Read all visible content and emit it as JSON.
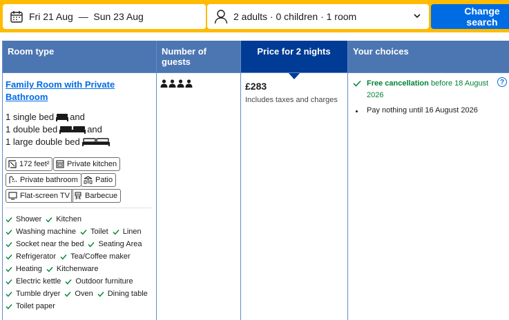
{
  "search": {
    "dates": "Fri 21 Aug  —  Sun 23 Aug",
    "guests": "2 adults · 0 children · 1 room",
    "change_label": "Change search"
  },
  "table": {
    "headers": [
      "Room type",
      "Number of guests",
      "Price for 2 nights",
      "Your choices"
    ]
  },
  "room": {
    "name": "Family Room with Private Bathroom",
    "beds": [
      {
        "text": "1 single bed",
        "suffix": "and"
      },
      {
        "text": "1 double bed",
        "suffix": "and"
      },
      {
        "text": "1 large double bed",
        "suffix": ""
      }
    ],
    "facilities": [
      "172 feet²",
      "Private kitchen",
      "Private bathroom",
      "Patio",
      "Flat-screen TV",
      "Barbecue"
    ],
    "amenities": [
      [
        "Shower",
        "Kitchen"
      ],
      [
        "Washing machine",
        "Toilet",
        "Linen"
      ],
      [
        "Socket near the bed",
        "Seating Area"
      ],
      [
        "Refrigerator",
        "Tea/Coffee maker"
      ],
      [
        "Heating",
        "Kitchenware"
      ],
      [
        "Electric kettle",
        "Outdoor furniture"
      ],
      [
        "Tumble dryer",
        "Oven",
        "Dining table"
      ],
      [
        "Toilet paper"
      ]
    ],
    "max_guests": 4
  },
  "price": {
    "amount": "£283",
    "note": "Includes taxes and charges"
  },
  "choices": {
    "free_cancellation": "Free cancellation",
    "free_cancellation_rest": "before 18 August 2026",
    "pay_nothing": "Pay nothing until 16 August 2026"
  },
  "colors": {
    "search_border": "#febb02",
    "primary_blue": "#006ce4",
    "header_blue": "#4c76b2",
    "header_dark": "#003b95",
    "green": "#008234"
  }
}
